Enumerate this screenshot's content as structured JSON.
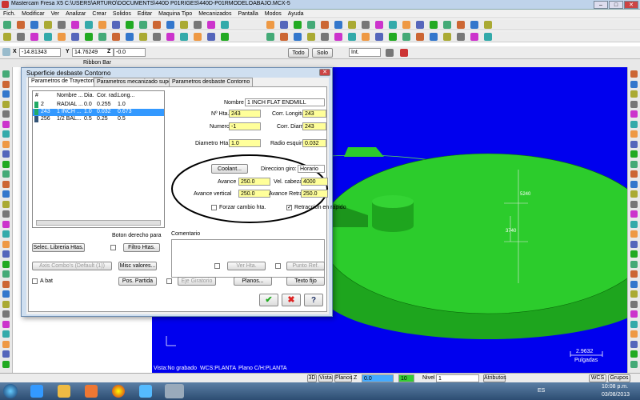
{
  "window": {
    "title": "Mastercam Fresa X5   C:\\USERS\\ARTURO\\DOCUMENTS\\440D P01RIGES\\440D-P01RMODELOABAJO.MCX-5"
  },
  "menu": [
    "Fich.",
    "Modificar",
    "Ver",
    "Analizar",
    "Crear",
    "Solidos",
    "Editar",
    "Maquina Tipo",
    "Mecanizados",
    "Pantalla",
    "Modos",
    "Ayuda"
  ],
  "coords": {
    "x_label": "X",
    "x_value": "-14.81343",
    "y_label": "Y",
    "y_value": "14.76249",
    "z_label": "Z",
    "z_value": "-0.0"
  },
  "toolbar2": {
    "todo": "Todo",
    "solo": "Solo",
    "int": "Int."
  },
  "ribbon": {
    "label": "Ribbon Bar"
  },
  "dialog": {
    "title": "Superficie desbaste Contorno",
    "tabs": [
      "Parametros de Trayectorias",
      "Parametros mecanizado superficie",
      "Parametros desbaste Contorno"
    ],
    "list_headers": [
      "#",
      "Nombre ...",
      "Dia.",
      "Cor. rad.",
      "Long..."
    ],
    "tools": [
      {
        "num": "2",
        "name": "RADIAL ...",
        "dia": "0.0",
        "cor": "0.255",
        "long": "1.0"
      },
      {
        "num": "243",
        "name": "1 INCH ...",
        "dia": "1.0",
        "cor": "0.032",
        "long": "0.673"
      },
      {
        "num": "256",
        "name": "1/2 BAL...",
        "dia": "0.5",
        "cor": "0.25",
        "long": "0.5"
      }
    ],
    "nombre_label": "Nombre",
    "nombre_value": "1 INCH FLAT ENDMILL",
    "nhta_label": "Nº Hta.",
    "nhta_value": "243",
    "corr_long_label": "Corr. Longitud",
    "corr_long_value": "243",
    "numero_label": "Numero",
    "numero_value": "-1",
    "corr_diam_label": "Corr. Diam.",
    "corr_diam_value": "243",
    "diam_label": "Diametro Hta.",
    "diam_value": "1.0",
    "radio_label": "Radio esquina",
    "radio_value": "0.032",
    "coolant_btn": "Coolant...",
    "direccion_label": "Direccion giro:",
    "direccion_value": "Horario",
    "avance_label": "Avance",
    "avance_value": "250.0",
    "vel_label": "Vel. cabezal",
    "vel_value": "4000",
    "avance_vert_label": "Avance vertical",
    "avance_vert_value": "250.0",
    "avance_retrac_label": "Avance Retrac.",
    "avance_retrac_value": "250.0",
    "forzar_label": "Forzar cambio hta.",
    "retraccion_label": "Retraccion en rapido",
    "comentario_label": "Comentario",
    "boton_derecho": "Boton derecho para",
    "selec_btn": "Selec. Libreria Htas.",
    "filtro_btn": "Filtro Htas.",
    "axis_combo": "Axis Combo's (Default (1))",
    "misc_btn": "Misc valores...",
    "ver_hta_btn": "Ver Hta.",
    "punto_ref_btn": "Punto Ref.",
    "abat_label": "A bat",
    "pos_partida_btn": "Pos. Partida",
    "eje_giratorio_btn": "Eje Giratorio",
    "planos_btn": "Planos...",
    "texto_fijo_btn": "Texto fijo"
  },
  "viewport": {
    "dim1": "5240",
    "dim2": "3740",
    "scale_value": "2.9632",
    "scale_unit": "Pulgadas"
  },
  "status": {
    "vista": "Vista:No grabado",
    "wcs": "WCS:PLANTA",
    "plano": "Plano C/H:PLANTA"
  },
  "bottom": {
    "d3": "3D",
    "vista": "Vista",
    "planos": "Planos",
    "z": "Z",
    "z_value": "0.0",
    "color": "10",
    "nivel_label": "Nivel",
    "nivel_value": "1",
    "atributos": "Atributos",
    "wcs": "WCS",
    "grupos": "Grupos"
  },
  "taskbar": {
    "lang": "ES",
    "time": "10:08 p.m.",
    "date": "03/08/2013"
  },
  "colors": {
    "viewport_bg": "#0000ee",
    "solid": "#22bb22",
    "highlight": "#ffff9a"
  }
}
